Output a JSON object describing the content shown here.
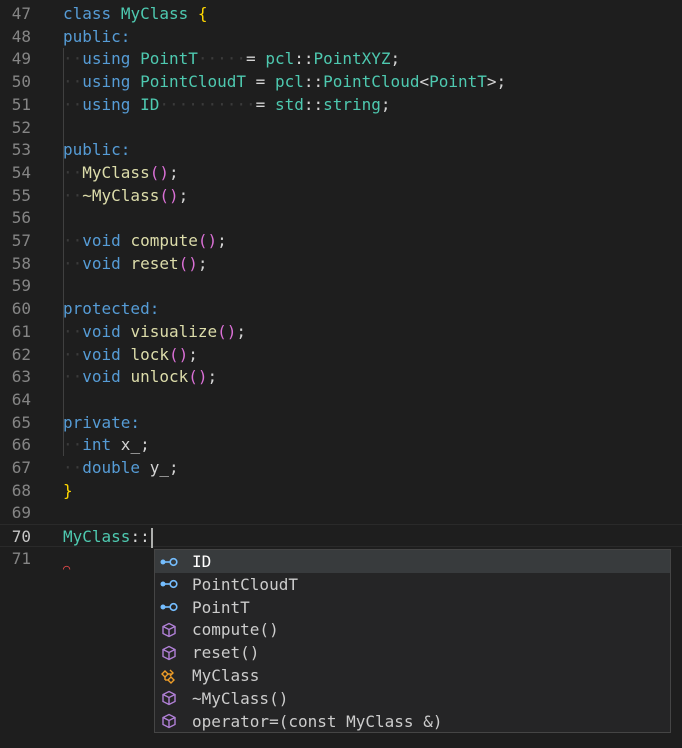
{
  "editor": {
    "lines": [
      {
        "num": "47",
        "tokens": [
          [
            "kw",
            "class"
          ],
          [
            "pn",
            " "
          ],
          [
            "ty",
            "MyClass"
          ],
          [
            "pn",
            " "
          ],
          [
            "br1",
            "{"
          ]
        ]
      },
      {
        "num": "48",
        "tokens": [
          [
            "kw",
            "public:"
          ]
        ]
      },
      {
        "num": "49",
        "tokens": [
          [
            "ws",
            "··"
          ],
          [
            "kw",
            "using"
          ],
          [
            "pn",
            " "
          ],
          [
            "ty",
            "PointT"
          ],
          [
            "ws",
            "·····"
          ],
          [
            "pn",
            "= "
          ],
          [
            "ty",
            "pcl"
          ],
          [
            "pn",
            "::"
          ],
          [
            "ty",
            "PointXYZ"
          ],
          [
            "pn",
            ";"
          ]
        ]
      },
      {
        "num": "50",
        "tokens": [
          [
            "ws",
            "··"
          ],
          [
            "kw",
            "using"
          ],
          [
            "pn",
            " "
          ],
          [
            "ty",
            "PointCloudT"
          ],
          [
            "pn",
            " = "
          ],
          [
            "ty",
            "pcl"
          ],
          [
            "pn",
            "::"
          ],
          [
            "ty",
            "PointCloud"
          ],
          [
            "pn",
            "<"
          ],
          [
            "ty",
            "PointT"
          ],
          [
            "pn",
            ">;"
          ]
        ]
      },
      {
        "num": "51",
        "tokens": [
          [
            "ws",
            "··"
          ],
          [
            "kw",
            "using"
          ],
          [
            "pn",
            " "
          ],
          [
            "ty",
            "ID"
          ],
          [
            "ws",
            "··········"
          ],
          [
            "pn",
            "= "
          ],
          [
            "ty",
            "std"
          ],
          [
            "pn",
            "::"
          ],
          [
            "ty",
            "string"
          ],
          [
            "pn",
            ";"
          ]
        ]
      },
      {
        "num": "52",
        "tokens": []
      },
      {
        "num": "53",
        "tokens": [
          [
            "kw",
            "public:"
          ]
        ]
      },
      {
        "num": "54",
        "tokens": [
          [
            "ws",
            "··"
          ],
          [
            "fn",
            "MyClass"
          ],
          [
            "br2",
            "()"
          ],
          [
            "pn",
            ";"
          ]
        ]
      },
      {
        "num": "55",
        "tokens": [
          [
            "ws",
            "··"
          ],
          [
            "fn",
            "~MyClass"
          ],
          [
            "br2",
            "()"
          ],
          [
            "pn",
            ";"
          ]
        ]
      },
      {
        "num": "56",
        "tokens": []
      },
      {
        "num": "57",
        "tokens": [
          [
            "ws",
            "··"
          ],
          [
            "kw",
            "void"
          ],
          [
            "pn",
            " "
          ],
          [
            "fn",
            "compute"
          ],
          [
            "br2",
            "()"
          ],
          [
            "pn",
            ";"
          ]
        ]
      },
      {
        "num": "58",
        "tokens": [
          [
            "ws",
            "··"
          ],
          [
            "kw",
            "void"
          ],
          [
            "pn",
            " "
          ],
          [
            "fn",
            "reset"
          ],
          [
            "br2",
            "()"
          ],
          [
            "pn",
            ";"
          ]
        ]
      },
      {
        "num": "59",
        "tokens": []
      },
      {
        "num": "60",
        "tokens": [
          [
            "kw",
            "protected:"
          ]
        ]
      },
      {
        "num": "61",
        "tokens": [
          [
            "ws",
            "··"
          ],
          [
            "kw",
            "void"
          ],
          [
            "pn",
            " "
          ],
          [
            "fn",
            "visualize"
          ],
          [
            "br2",
            "()"
          ],
          [
            "pn",
            ";"
          ]
        ]
      },
      {
        "num": "62",
        "tokens": [
          [
            "ws",
            "··"
          ],
          [
            "kw",
            "void"
          ],
          [
            "pn",
            " "
          ],
          [
            "fn",
            "lock"
          ],
          [
            "br2",
            "()"
          ],
          [
            "pn",
            ";"
          ]
        ]
      },
      {
        "num": "63",
        "tokens": [
          [
            "ws",
            "··"
          ],
          [
            "kw",
            "void"
          ],
          [
            "pn",
            " "
          ],
          [
            "fn",
            "unlock"
          ],
          [
            "br2",
            "()"
          ],
          [
            "pn",
            ";"
          ]
        ]
      },
      {
        "num": "64",
        "tokens": []
      },
      {
        "num": "65",
        "tokens": [
          [
            "kw",
            "private:"
          ]
        ]
      },
      {
        "num": "66",
        "tokens": [
          [
            "ws",
            "··"
          ],
          [
            "kw",
            "int"
          ],
          [
            "pn",
            " x_;"
          ]
        ]
      },
      {
        "num": "67",
        "tokens": [
          [
            "ws",
            "··"
          ],
          [
            "kw",
            "double"
          ],
          [
            "pn",
            " y_;"
          ]
        ]
      },
      {
        "num": "68",
        "tokens": [
          [
            "br1",
            "}"
          ]
        ]
      },
      {
        "num": "69",
        "tokens": []
      },
      {
        "num": "70",
        "tokens": [
          [
            "ty",
            "MyClass"
          ],
          [
            "pn",
            "::"
          ]
        ],
        "current": true
      },
      {
        "num": "71",
        "tokens": []
      }
    ]
  },
  "suggest": {
    "items": [
      {
        "label": "ID",
        "icon": "field-icon",
        "selected": true
      },
      {
        "label": "PointCloudT",
        "icon": "field-icon"
      },
      {
        "label": "PointT",
        "icon": "field-icon"
      },
      {
        "label": "compute()",
        "icon": "method-icon"
      },
      {
        "label": "reset()",
        "icon": "method-icon"
      },
      {
        "label": "MyClass",
        "icon": "class-icon"
      },
      {
        "label": "~MyClass()",
        "icon": "method-icon"
      },
      {
        "label": "operator=(const MyClass &)",
        "icon": "method-icon"
      }
    ]
  },
  "colors": {
    "background": "#1e1e1e",
    "keyword": "#569cd6",
    "type": "#4ec9b0",
    "function": "#dcdcaa",
    "bracket_gold": "#ffd700",
    "bracket_purple": "#da70d6",
    "field_icon": "#75beff",
    "method_icon": "#b180d7",
    "class_icon": "#ee9d28"
  }
}
